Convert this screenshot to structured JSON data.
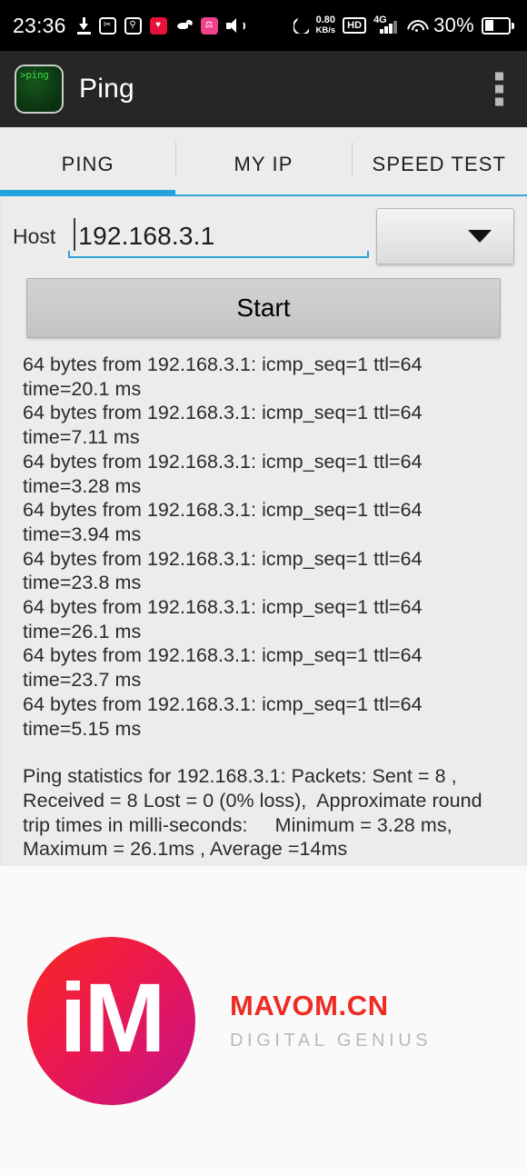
{
  "statusbar": {
    "clock": "23:36",
    "left_icons": [
      {
        "name": "download-icon",
        "glyph": ""
      },
      {
        "name": "scissors-box-icon",
        "glyph": "✂"
      },
      {
        "name": "search-circle-icon",
        "glyph": "ⓘ"
      },
      {
        "name": "heart-notification-icon",
        "glyph": "♥"
      },
      {
        "name": "bird-app-icon",
        "glyph": ""
      },
      {
        "name": "pink-app-icon",
        "glyph": "⌘"
      },
      {
        "name": "volume-icon",
        "glyph": ""
      }
    ],
    "moon_icon": "do-not-disturb-moon",
    "network_speed": "0.80",
    "network_speed_unit": "KB/s",
    "hd_label": "HD",
    "signal_label": "4G",
    "wifi_icon": "wifi-icon",
    "battery_percent": "30%"
  },
  "actionbar": {
    "app_icon_text": ">ping",
    "title": "Ping",
    "overflow_label": "more-options"
  },
  "tabs": [
    {
      "label": "PING",
      "active": true
    },
    {
      "label": "MY IP",
      "active": false
    },
    {
      "label": "SPEED TEST",
      "active": false
    }
  ],
  "form": {
    "host_label": "Host",
    "host_value": "192.168.3.1",
    "host_placeholder": "Host",
    "spinner_value": "",
    "spinner_options": [],
    "start_label": "Start"
  },
  "output": {
    "ping_log": "64 bytes from 192.168.3.1: icmp_seq=1 ttl=64 time=20.1 ms\n64 bytes from 192.168.3.1: icmp_seq=1 ttl=64 time=7.11 ms\n64 bytes from 192.168.3.1: icmp_seq=1 ttl=64 time=3.28 ms\n64 bytes from 192.168.3.1: icmp_seq=1 ttl=64 time=3.94 ms\n64 bytes from 192.168.3.1: icmp_seq=1 ttl=64 time=23.8 ms\n64 bytes from 192.168.3.1: icmp_seq=1 ttl=64 time=26.1 ms\n64 bytes from 192.168.3.1: icmp_seq=1 ttl=64 time=23.7 ms\n64 bytes from 192.168.3.1: icmp_seq=1 ttl=64 time=5.15 ms",
    "statistics": "Ping statistics for 192.168.3.1: Packets: Sent = 8 , Received = 8 Lost = 0 (0% loss),  Approximate round trip times in milli-seconds:     Minimum = 3.28 ms, Maximum = 26.1ms , Average =14ms"
  },
  "watermark": {
    "logo_text": "iM",
    "brand": "MAVOM.CN",
    "tagline": "DIGITAL GENIUS"
  },
  "colors": {
    "accent_blue": "#23a3dd",
    "actionbar_bg": "#262626",
    "content_bg": "#ececec",
    "brand_red": "#ee2c24"
  }
}
